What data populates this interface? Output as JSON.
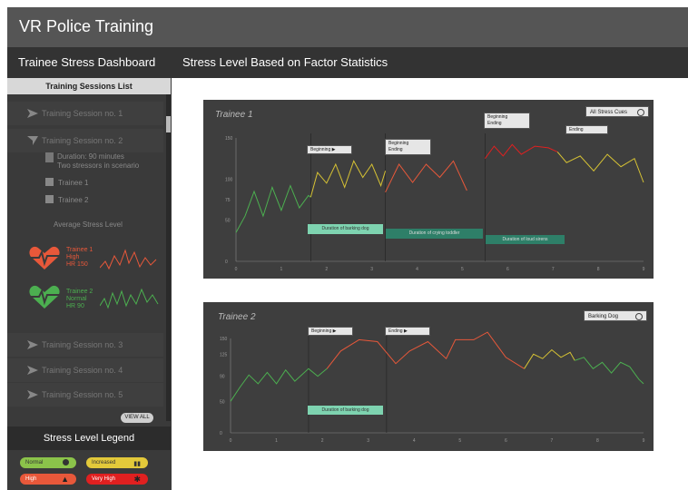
{
  "app": {
    "title": "VR Police Training"
  },
  "tabs": {
    "dashboard": "Trainee Stress Dashboard",
    "stress": "Stress Level Based on Factor Statistics"
  },
  "sidebar": {
    "header": "Training Sessions List",
    "session1": "Training Session no. 1",
    "session2": "Training Session no. 2",
    "duration": "Duration: 90 minutes",
    "stressors": "Two stressors in scenario",
    "trainee1": "Trainee 1",
    "trainee2": "Trainee 2",
    "avg_title": "Average Stress Level",
    "t1": {
      "name": "Trainee 1",
      "level": "High",
      "hr": "HR 150"
    },
    "t2": {
      "name": "Trainee 2",
      "level": "Normal",
      "hr": "HR 90"
    },
    "session3": "Training Session no. 3",
    "session4": "Training Session no. 4",
    "session5": "Training Session no. 5",
    "view_all": "VIEW ALL"
  },
  "legend": {
    "title": "Stress Level Legend",
    "normal": "Normal",
    "increased": "Increased",
    "high": "High",
    "very_high": "Very High"
  },
  "colors": {
    "normal": "#4caf50",
    "increased": "#d6c234",
    "high": "#e8583a",
    "very_high": "#e02020"
  },
  "chart1": {
    "title": "Trainee 1",
    "filter": "All Stress Cues",
    "cues": [
      "Beginning",
      "Beginning",
      "Ending",
      "Beginning",
      "Ending",
      "Ending"
    ],
    "durations": [
      "Duration of barking dog",
      "Duration of crying toddler",
      "Duration of loud sirens"
    ]
  },
  "chart2": {
    "title": "Trainee 2",
    "filter": "Barking Dog",
    "cues": [
      "Beginning",
      "Ending"
    ],
    "durations": [
      "Duration of barking dog"
    ]
  },
  "chart_data": [
    {
      "type": "line",
      "title": "Trainee 1",
      "ylim": [
        0,
        150
      ],
      "yticks": [
        0,
        50,
        75,
        100,
        150
      ],
      "xticks": [
        0,
        1,
        2,
        3,
        4,
        5,
        6,
        7,
        8,
        9
      ],
      "xlim": [
        0,
        9
      ],
      "series": [
        {
          "name": "Normal",
          "color": "#4caf50",
          "points": [
            [
              0,
              35
            ],
            [
              0.2,
              55
            ],
            [
              0.4,
              85
            ],
            [
              0.6,
              55
            ],
            [
              0.8,
              90
            ],
            [
              1.0,
              62
            ],
            [
              1.2,
              92
            ],
            [
              1.4,
              65
            ],
            [
              1.6,
              80
            ],
            [
              1.65,
              78
            ]
          ]
        },
        {
          "name": "Increased",
          "color": "#d6c234",
          "points": [
            [
              1.65,
              78
            ],
            [
              1.8,
              108
            ],
            [
              2.0,
              95
            ],
            [
              2.2,
              118
            ],
            [
              2.4,
              90
            ],
            [
              2.6,
              122
            ],
            [
              2.8,
              102
            ],
            [
              3.0,
              118
            ],
            [
              3.2,
              92
            ],
            [
              3.3,
              110
            ]
          ]
        },
        {
          "name": "High",
          "color": "#e8583a",
          "points": [
            [
              3.3,
              84
            ],
            [
              3.6,
              118
            ],
            [
              3.9,
              96
            ],
            [
              4.2,
              118
            ],
            [
              4.5,
              102
            ],
            [
              4.8,
              122
            ],
            [
              5.1,
              86
            ]
          ]
        },
        {
          "name": "Very High",
          "color": "#e02020",
          "points": [
            [
              5.5,
              125
            ],
            [
              5.7,
              140
            ],
            [
              5.9,
              128
            ],
            [
              6.1,
              142
            ],
            [
              6.3,
              130
            ],
            [
              6.6,
              140
            ],
            [
              6.9,
              138
            ],
            [
              7.1,
              133
            ]
          ]
        },
        {
          "name": "Increased",
          "color": "#d6c234",
          "points": [
            [
              7.1,
              133
            ],
            [
              7.3,
              120
            ],
            [
              7.6,
              128
            ],
            [
              7.9,
              110
            ],
            [
              8.2,
              130
            ],
            [
              8.5,
              115
            ],
            [
              8.8,
              125
            ],
            [
              9.0,
              96
            ]
          ]
        }
      ]
    },
    {
      "type": "line",
      "title": "Trainee 2",
      "ylim": [
        0,
        150
      ],
      "yticks": [
        0,
        50,
        90,
        125,
        150
      ],
      "xticks": [
        0,
        1,
        2,
        3,
        4,
        5,
        6,
        7,
        8,
        9
      ],
      "xlim": [
        0,
        9
      ],
      "series": [
        {
          "name": "Normal",
          "color": "#4caf50",
          "points": [
            [
              0,
              50
            ],
            [
              0.2,
              72
            ],
            [
              0.4,
              92
            ],
            [
              0.6,
              78
            ],
            [
              0.8,
              96
            ],
            [
              1.0,
              78
            ],
            [
              1.2,
              100
            ],
            [
              1.4,
              82
            ],
            [
              1.7,
              102
            ],
            [
              1.9,
              90
            ],
            [
              2.1,
              102
            ]
          ]
        },
        {
          "name": "High",
          "color": "#e8583a",
          "points": [
            [
              2.1,
              102
            ],
            [
              2.4,
              130
            ],
            [
              2.8,
              148
            ],
            [
              3.2,
              145
            ],
            [
              3.6,
              110
            ],
            [
              3.9,
              130
            ],
            [
              4.3,
              145
            ],
            [
              4.7,
              118
            ],
            [
              4.9,
              148
            ],
            [
              5.3,
              148
            ],
            [
              5.6,
              160
            ],
            [
              6.0,
              120
            ],
            [
              6.4,
              102
            ]
          ]
        },
        {
          "name": "Increased",
          "color": "#d6c234",
          "points": [
            [
              6.4,
              102
            ],
            [
              6.6,
              125
            ],
            [
              6.8,
              118
            ],
            [
              7.0,
              132
            ],
            [
              7.2,
              120
            ],
            [
              7.4,
              128
            ],
            [
              7.5,
              115
            ]
          ]
        },
        {
          "name": "Normal",
          "color": "#4caf50",
          "points": [
            [
              7.5,
              115
            ],
            [
              7.7,
              120
            ],
            [
              7.9,
              102
            ],
            [
              8.1,
              112
            ],
            [
              8.3,
              95
            ],
            [
              8.5,
              112
            ],
            [
              8.7,
              105
            ],
            [
              8.9,
              85
            ],
            [
              9.0,
              78
            ]
          ]
        }
      ]
    }
  ]
}
